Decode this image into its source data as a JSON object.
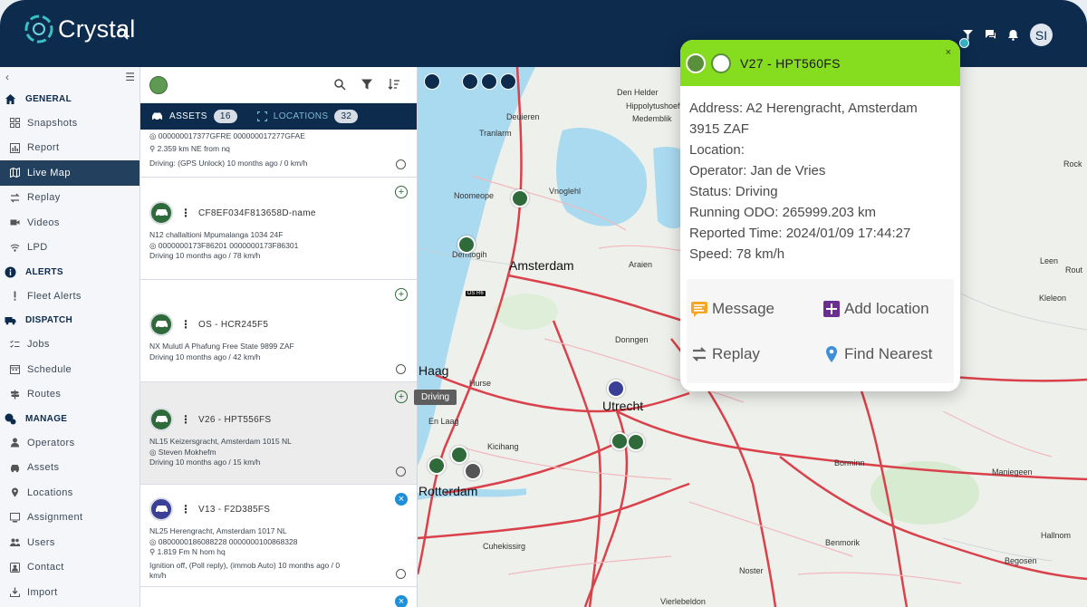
{
  "app": {
    "name": "Crystal",
    "user_initials": "SI"
  },
  "sidebar": {
    "sections": [
      {
        "label": "GENERAL",
        "icon": "home-icon",
        "items": [
          {
            "label": "Snapshots",
            "icon": "grid-icon"
          },
          {
            "label": "Report",
            "icon": "bar-chart-icon"
          },
          {
            "label": "Live Map",
            "icon": "map-icon",
            "active": true
          },
          {
            "label": "Replay",
            "icon": "replay-icon"
          },
          {
            "label": "Videos",
            "icon": "video-icon"
          },
          {
            "label": "LPD",
            "icon": "wifi-icon"
          }
        ]
      },
      {
        "label": "ALERTS",
        "icon": "info-icon",
        "items": [
          {
            "label": "Fleet Alerts",
            "icon": "exclamation-icon"
          }
        ]
      },
      {
        "label": "DISPATCH",
        "icon": "truck-icon",
        "items": [
          {
            "label": "Jobs",
            "icon": "list-icon"
          },
          {
            "label": "Schedule",
            "icon": "calendar-icon"
          },
          {
            "label": "Routes",
            "icon": "signpost-icon"
          }
        ]
      },
      {
        "label": "MANAGE",
        "icon": "manage-icon",
        "items": [
          {
            "label": "Operators",
            "icon": "person-icon"
          },
          {
            "label": "Assets",
            "icon": "car-icon"
          },
          {
            "label": "Locations",
            "icon": "location-icon"
          },
          {
            "label": "Assignment",
            "icon": "monitor-icon"
          },
          {
            "label": "Users",
            "icon": "users-icon"
          },
          {
            "label": "Contact",
            "icon": "contact-icon"
          },
          {
            "label": "Import",
            "icon": "import-icon"
          }
        ]
      }
    ]
  },
  "panel": {
    "tabs": [
      {
        "label": "ASSETS",
        "count": "16"
      },
      {
        "label": "LOCATIONS",
        "count": "32"
      }
    ],
    "assets": [
      {
        "name": "",
        "lines": [
          "000000017377GFRE 000000017277GFAE",
          "2.359 km NE from nq",
          "Driving: (GPS Unlock) 10 months ago / 0 km/h"
        ]
      },
      {
        "name": "CF8EF034F813658D-name",
        "lines": [
          "N12 challaltioni Mpumalanga 1034 24F",
          "0000000173F86201 0000000173F86301",
          "Driving 10 months ago / 78 km/h"
        ]
      },
      {
        "name": "OS - HCR245F5",
        "lines": [
          "NX Mulutl A Phafung Free State 9899 ZAF",
          "Driving 10 months ago / 42 km/h"
        ]
      },
      {
        "name": "V26 - HPT556FS",
        "lines": [
          "NL15 Keizersgracht, Amsterdam 1015 NL",
          "Steven Mokhefm",
          "Driving 10 months ago / 15 km/h"
        ]
      },
      {
        "name": "V13 - F2D385FS",
        "lines": [
          "NL25 Herengracht, Amsterdam 1017 NL",
          "0800000186088228 0000000100868328",
          "1.819 Fm N hom hq",
          "Ignition off, (Poll reply), (immob Auto) 10 months ago / 0",
          "km/h"
        ]
      }
    ],
    "tooltip": "Driving"
  },
  "map": {
    "cities": [
      "Amsterdam",
      "Haag",
      "Utrecht",
      "Rotterdam"
    ],
    "places": [
      "Den Helder",
      "Hippolytushoef",
      "Medemblik",
      "Deuieren",
      "Tranlarm",
      "Noomeope",
      "Vnoglehl",
      "Demtogih",
      "Hurse",
      "Donngen",
      "Araien",
      "En Laag",
      "Kicihang",
      "Cuhekissirg",
      "Noster",
      "Vierlebeldon",
      "Benmorik",
      "Borminn",
      "Maniegeen",
      "Begosen",
      "Hallnom",
      "Rock",
      "Leen",
      "Kleleon",
      "Rout"
    ],
    "badge": "DS R6"
  },
  "popup": {
    "title": "V27 - HPT560FS",
    "address_label": "Address:",
    "address": "A2 Herengracht, Amsterdam",
    "address2": "3915 ZAF",
    "location_label": "Location:",
    "operator_label": "Operator:",
    "operator": "Jan de Vries",
    "status_label": "Status:",
    "status": "Driving",
    "odo_label": "Running ODO:",
    "odo": "265999.203 km",
    "time_label": "Reported Time:",
    "time": "2024/01/09 17:44:27",
    "speed_label": "Speed:",
    "speed": "78 km/h",
    "actions": {
      "message": "Message",
      "add_location": "Add location",
      "replay": "Replay",
      "find_nearest": "Find Nearest"
    }
  }
}
